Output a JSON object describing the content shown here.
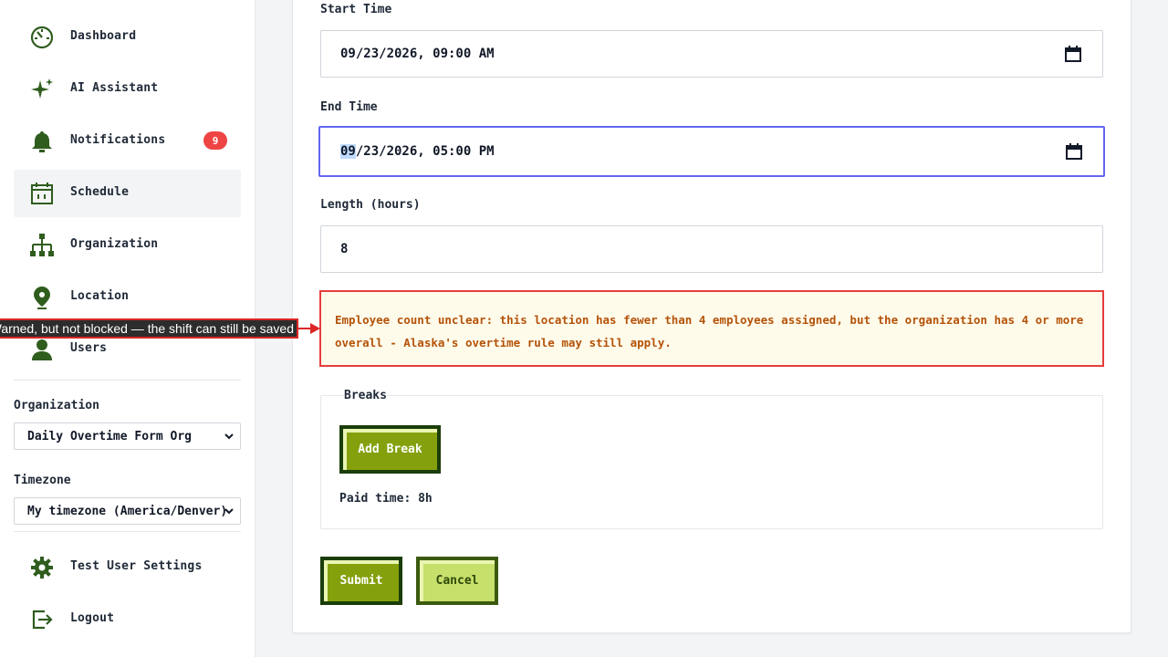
{
  "sidebar": {
    "nav": [
      {
        "label": "Dashboard",
        "icon": "dashboard-gauge-icon"
      },
      {
        "label": "AI Assistant",
        "icon": "sparkle-icon"
      },
      {
        "label": "Notifications",
        "icon": "bell-icon",
        "badge": "9"
      },
      {
        "label": "Schedule",
        "icon": "calendar-icon",
        "active": true
      },
      {
        "label": "Organization",
        "icon": "org-chart-icon"
      },
      {
        "label": "Location",
        "icon": "map-pin-icon"
      },
      {
        "label": "Users",
        "icon": "user-icon"
      }
    ],
    "organization": {
      "label": "Organization",
      "value": "Daily Overtime Form Org"
    },
    "timezone": {
      "label": "Timezone",
      "value": "My timezone (America/Denver)"
    },
    "footer": [
      {
        "label": "Test User Settings",
        "icon": "gear-icon"
      },
      {
        "label": "Logout",
        "icon": "logout-icon"
      }
    ]
  },
  "form": {
    "start_time": {
      "label": "Start Time",
      "value": "09/23/2026, 09:00 AM"
    },
    "end_time": {
      "label": "End Time",
      "value_highlight": "09",
      "value_rest": "/23/2026, 05:00 PM"
    },
    "length": {
      "label": "Length (hours)",
      "value": "8"
    },
    "warning": "Employee count unclear: this location has fewer than 4 employees assigned, but the organization has 4 or more overall - Alaska's overtime rule may still apply.",
    "breaks": {
      "title": "Breaks",
      "add_label": "Add Break",
      "paid_time": "Paid time: 8h"
    },
    "submit_label": "Submit",
    "cancel_label": "Cancel"
  },
  "annotation": {
    "text": "Warned, but not blocked — the shift can still be saved"
  },
  "colors": {
    "brand_green": "#84a10d",
    "dark_green": "#1a3d0a",
    "icon_green": "#2f5d1e",
    "focus": "#6366f1",
    "warning_border": "#e53e3e",
    "warning_bg": "#fffbeb",
    "warning_text": "#b45309",
    "badge": "#ef4444"
  }
}
